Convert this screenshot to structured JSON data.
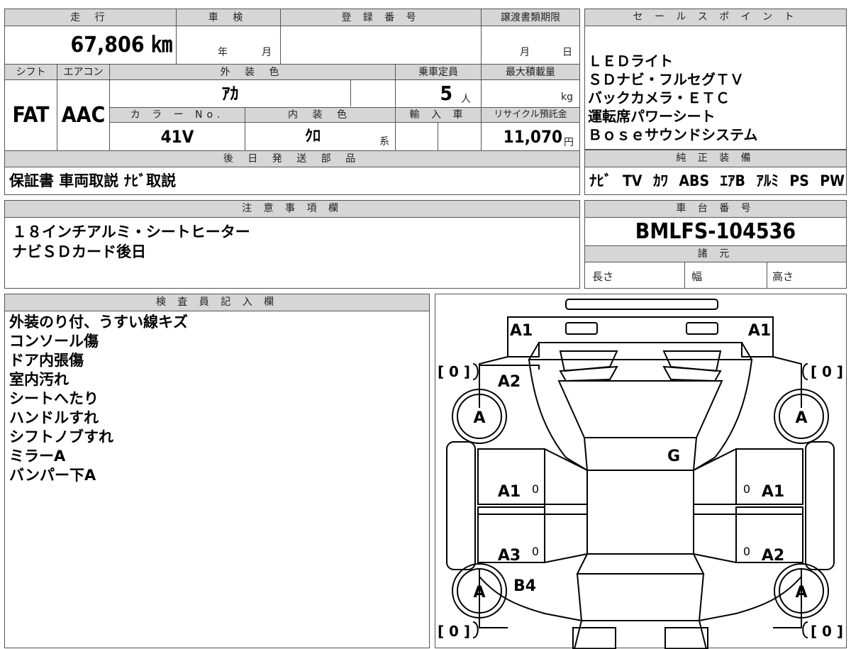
{
  "vehicle_info": {
    "mileage_label": "走 行",
    "mileage_value": "67,806 ㎞",
    "inspection_label": "車 検",
    "inspection_year": "年",
    "inspection_month": "月",
    "registration_label": "登 録 番 号",
    "transfer_docs_label": "譲渡書類期限",
    "transfer_month": "月",
    "transfer_day": "日",
    "shift_label": "シフト",
    "ac_label": "エアコン",
    "exterior_color_label": "外 装 色",
    "capacity_label": "乗車定員",
    "max_load_label": "最大積載量",
    "shift_value": "FAT",
    "ac_value": "AAC",
    "exterior_color_value": "ｱｶ",
    "capacity_value": "5",
    "capacity_unit": "人",
    "max_load_unit": "kg",
    "color_no_label": "カ ラ ー No.",
    "interior_color_label": "内 装 色",
    "import_label": "輸 入 車",
    "recycle_label": "リサイクル預託金",
    "color_no_value": "41V",
    "interior_color_value": "ｸﾛ",
    "interior_suffix": "系",
    "recycle_value": "11,070",
    "recycle_unit": "円",
    "later_parts_label": "後 日 発 送 部 品",
    "later_parts_value": "保証書 車両取説 ﾅﾋﾞ取説"
  },
  "sales_points": {
    "label": "セ ー ル ス ポ イ ン ト",
    "lines": [
      "ＬＥＤライト",
      "ＳＤナビ・フルセグＴＶ",
      "バックカメラ・ＥＴＣ",
      "運転席パワーシート",
      "Ｂｏｓｅサウンドシステム"
    ]
  },
  "genuine_equipment": {
    "label": "純 正 装 備",
    "items": [
      "ﾅﾋﾞ",
      "TV",
      "ｶﾜ",
      "ABS",
      "ｴｱB",
      "ｱﾙﾐ",
      "PS",
      "PW"
    ]
  },
  "notes": {
    "label": "注 意 事 項 欄",
    "lines": [
      "１８インチアルミ・シートヒーター",
      "ナビＳＤカード後日"
    ]
  },
  "chassis": {
    "label": "車 台 番 号",
    "value": "BMLFS-104536",
    "specs_label": "諸 元",
    "length_label": "長さ",
    "width_label": "幅",
    "height_label": "高さ"
  },
  "inspector": {
    "label": "検 査 員 記 入 欄",
    "lines": [
      "外装のり付、うすい線キズ",
      "コンソール傷",
      "ドア内張傷",
      "室内汚れ",
      "シートへたり",
      "ハンドルすれ",
      "シフトノブすれ",
      "ミラーA",
      "バンパー下A"
    ]
  },
  "diagram": {
    "front_left": "A1",
    "front_right": "A1",
    "fender_left": "A2",
    "tire_fl": "A",
    "tire_fr": "A",
    "tire_rl": "A",
    "tire_rr": "A",
    "glass": "G",
    "door_fl": "A1",
    "door_fr": "A1",
    "door_rl": "A3",
    "door_rr": "A2",
    "rear_left": "B4",
    "bracket_fl": "[ 0 ]",
    "bracket_fr": "[ 0 ]",
    "bracket_rl": "[ 0 ]",
    "bracket_rr": "[ 0 ]",
    "zero_mark": "0"
  }
}
